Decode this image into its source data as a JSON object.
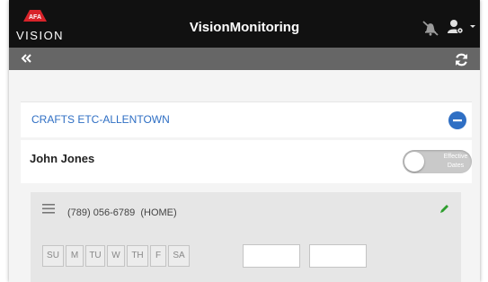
{
  "header": {
    "logo_badge": "AFA",
    "logo_word": "VISION",
    "title": "VisionMonitoring",
    "icons": {
      "mute": "bell-slash-icon",
      "user": "user-gear-icon",
      "dropdown": "caret-down-icon"
    }
  },
  "toolbar": {
    "back_icon": "double-chevron-left-icon",
    "refresh_icon": "refresh-icon"
  },
  "client": {
    "name": "CRAFTS ETC-ALLENTOWN",
    "collapse_icon": "minus-circle-icon"
  },
  "contact": {
    "name": "John Jones",
    "toggle": {
      "line1": "Effective",
      "line2": "Dates",
      "enabled": false
    }
  },
  "schedule": {
    "phone": "(789) 056-6789",
    "phone_type": "(HOME)",
    "days": [
      "SU",
      "M",
      "TU",
      "W",
      "TH",
      "F",
      "SA"
    ],
    "start_time": "",
    "end_time": ""
  },
  "colors": {
    "accent": "#2f6fc4",
    "header_bg": "#111111",
    "subbar_bg": "#666666",
    "logo_red": "#d8232a",
    "edit_green": "#2e9e2e"
  }
}
